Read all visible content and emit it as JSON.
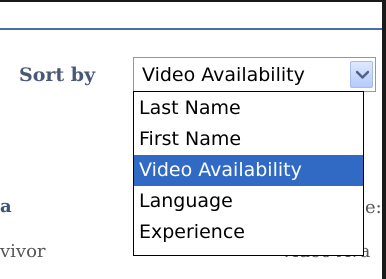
{
  "sort": {
    "label": "Sort by",
    "selected_value": "Video Availability",
    "options": [
      {
        "label": "Last Name",
        "selected": false
      },
      {
        "label": "First Name",
        "selected": false
      },
      {
        "label": "Video Availability",
        "selected": true
      },
      {
        "label": "Language",
        "selected": false
      },
      {
        "label": "Experience",
        "selected": false
      }
    ]
  },
  "background_text": {
    "left_bold_fragment": "a",
    "right_colon_fragment": "e:",
    "left_row_fragment": "vivor",
    "right_row_fragment": "Video Ava"
  },
  "colors": {
    "label": "#4a5877",
    "highlight": "#316ac5",
    "rule": "#4a6fa5"
  },
  "icons": {
    "dropdown_arrow": "chevron-down-icon"
  }
}
